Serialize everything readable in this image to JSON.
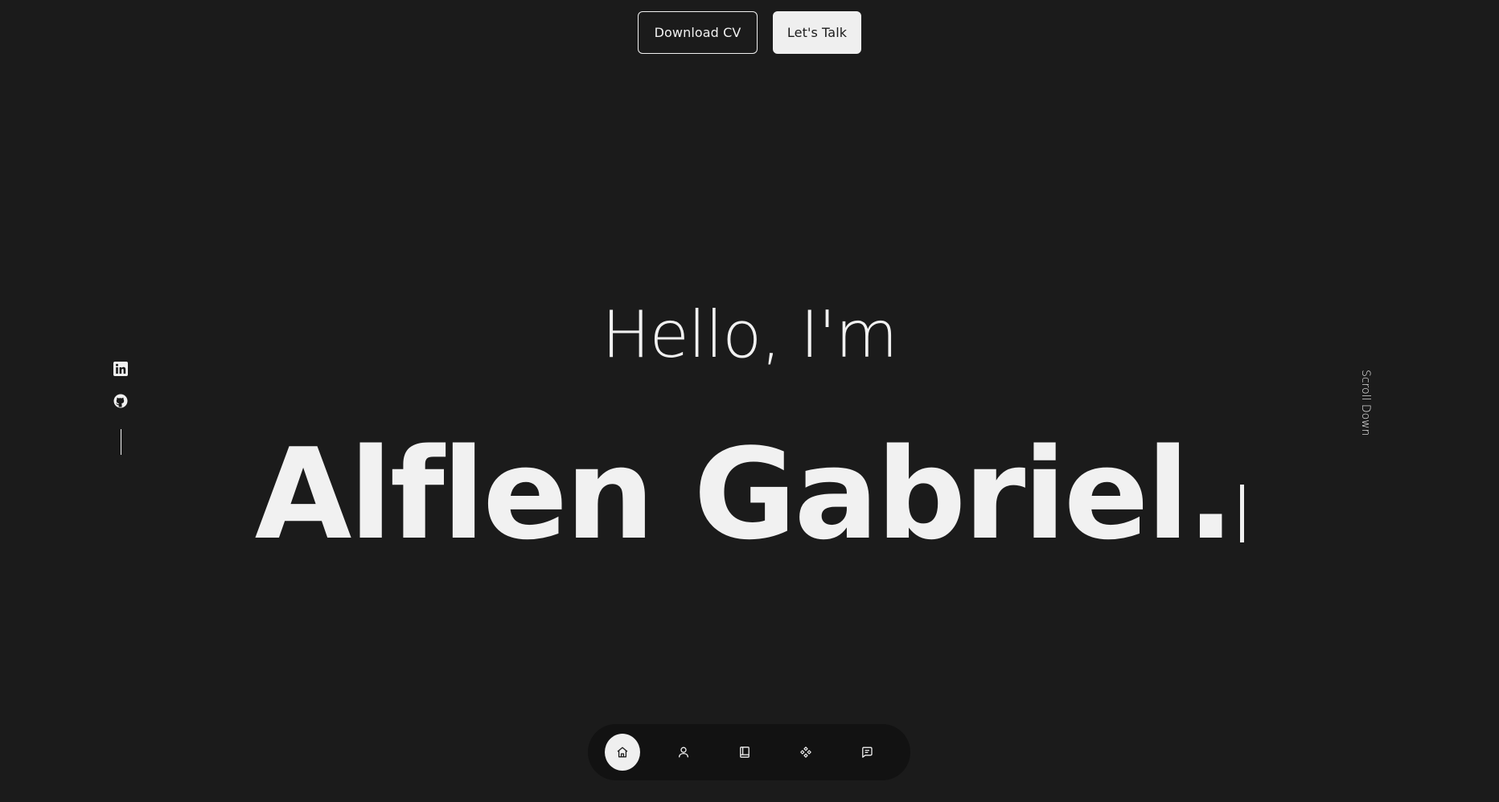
{
  "header": {
    "download_cv_label": "Download CV",
    "lets_talk_label": "Let's Talk"
  },
  "hero": {
    "greeting": "Hello, I'm",
    "name": "Alflen Gabriel."
  },
  "social": {
    "items": [
      {
        "icon": "linkedin-icon"
      },
      {
        "icon": "github-icon"
      }
    ]
  },
  "scroll": {
    "label": "Scroll Down"
  },
  "nav": {
    "items": [
      {
        "icon": "home-icon",
        "active": true
      },
      {
        "icon": "user-icon",
        "active": false
      },
      {
        "icon": "book-icon",
        "active": false
      },
      {
        "icon": "services-icon",
        "active": false
      },
      {
        "icon": "message-icon",
        "active": false
      }
    ]
  },
  "colors": {
    "background": "#1b1b1b",
    "foreground": "#f1f1f1",
    "nav_background": "#121212"
  }
}
